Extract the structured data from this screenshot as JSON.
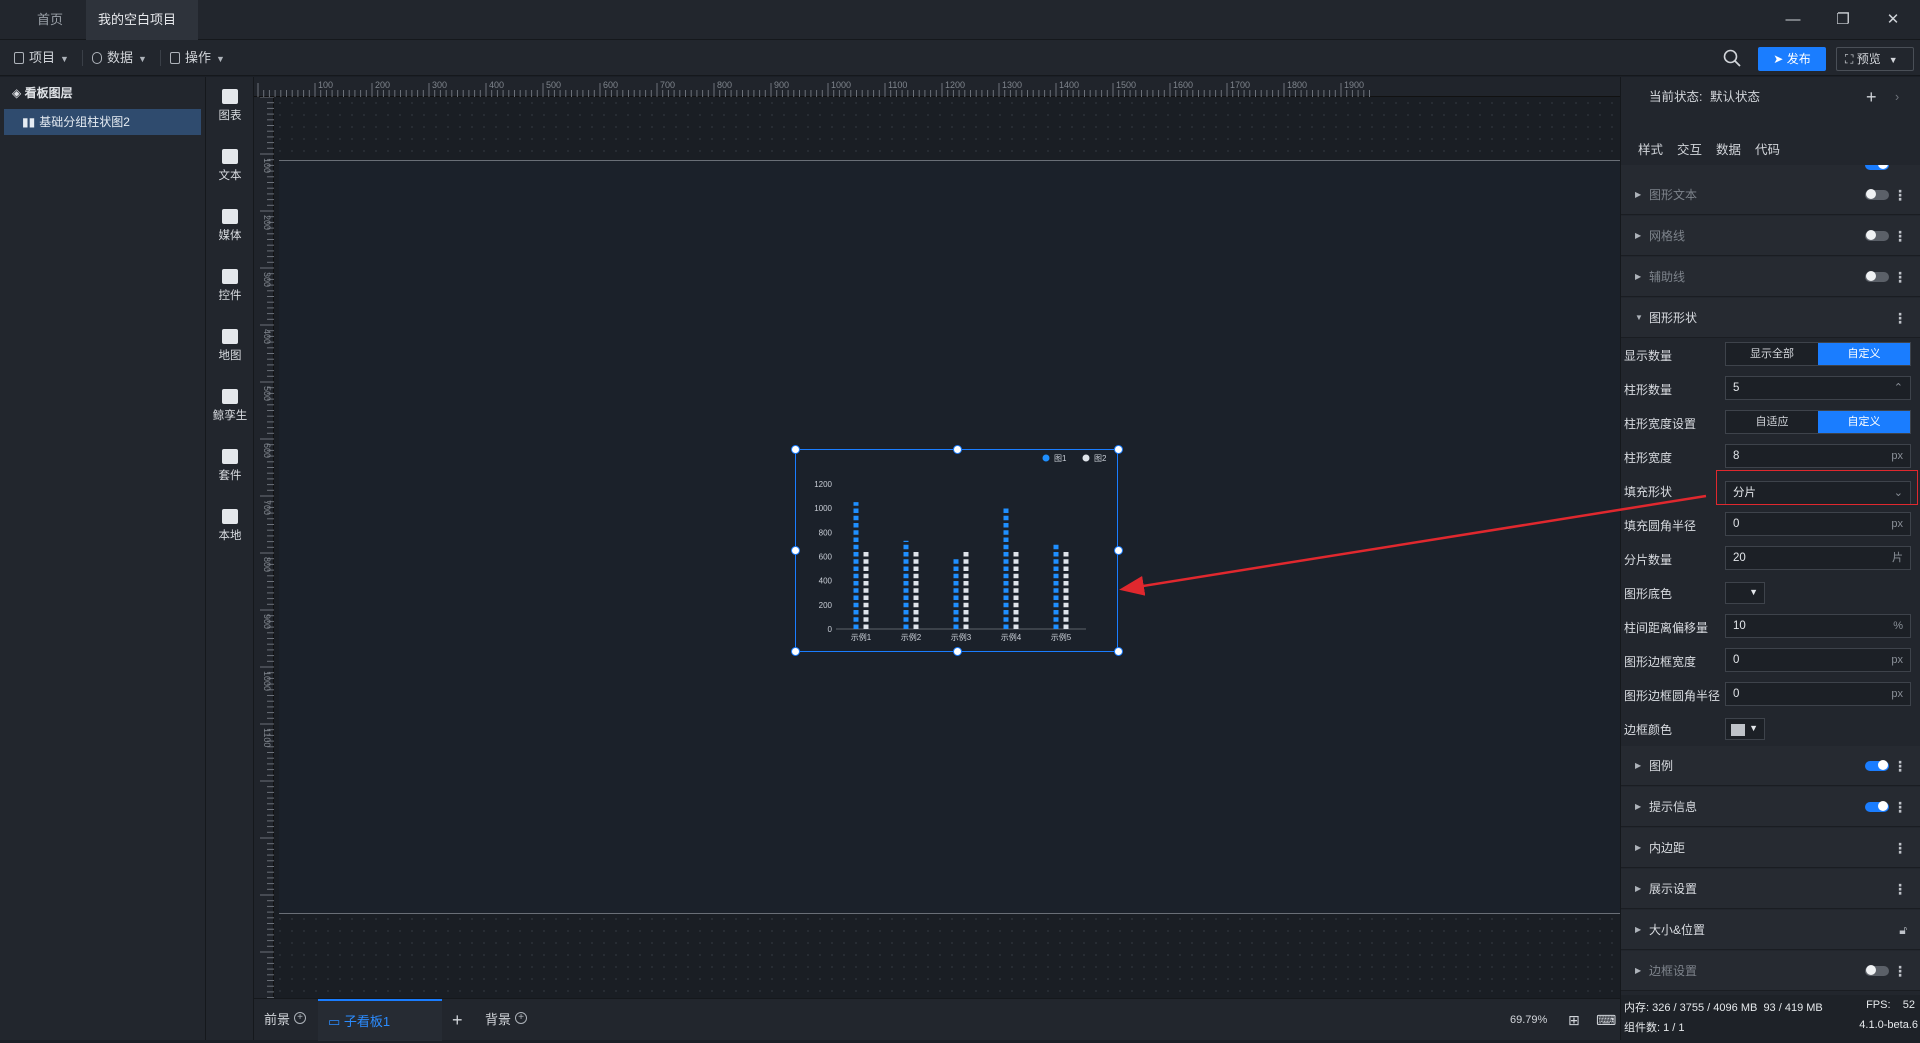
{
  "tabs": [
    {
      "label": "首页"
    },
    {
      "label": "我的空白项目"
    }
  ],
  "toolbar": {
    "project": "项目",
    "data": "数据",
    "ops": "操作",
    "publish": "发布",
    "preview": "预览"
  },
  "layers": {
    "title": "看板图层",
    "items": [
      {
        "label": "基础分组柱状图2"
      }
    ]
  },
  "components": [
    {
      "label": "图表"
    },
    {
      "label": "文本"
    },
    {
      "label": "媒体"
    },
    {
      "label": "控件"
    },
    {
      "label": "地图"
    },
    {
      "label": "鲸孪生"
    },
    {
      "label": "套件"
    },
    {
      "label": "本地"
    }
  ],
  "ruler": {
    "h": [
      "100",
      "200",
      "300",
      "400",
      "500",
      "600",
      "700",
      "800",
      "900",
      "1000",
      "1100",
      "1200",
      "1300",
      "1400",
      "1500",
      "1600",
      "1700",
      "1800",
      "1900"
    ],
    "v": [
      "100",
      "200",
      "300",
      "400",
      "500",
      "600",
      "700",
      "800",
      "900",
      "1000",
      "1100"
    ]
  },
  "chart_data": {
    "type": "bar",
    "categories": [
      "示例1",
      "示例2",
      "示例3",
      "示例4",
      "示例5"
    ],
    "series": [
      {
        "name": "图1",
        "values": [
          1050,
          730,
          590,
          1010,
          700
        ]
      },
      {
        "name": "图2",
        "values": [
          650,
          650,
          650,
          650,
          650
        ]
      }
    ],
    "yticks": [
      "0",
      "200",
      "400",
      "600",
      "800",
      "1000",
      "1200"
    ],
    "ylim": [
      0,
      1200
    ],
    "fill_shape": "分片",
    "segments": 20,
    "colors": [
      "#1f8fff",
      "#dfe4ea"
    ],
    "legend": "top-right"
  },
  "bottom": {
    "front": "前景",
    "board": "子看板1",
    "back": "背景",
    "zoom": "69.79%"
  },
  "props": {
    "state_label": "当前状态:",
    "state_value": "默认状态",
    "tabs": [
      "样式",
      "交互",
      "数据",
      "代码"
    ],
    "sections": {
      "text": "图形文本",
      "grid": "网格线",
      "aux": "辅助线",
      "shape": "图形形状",
      "legend": "图例",
      "tooltip": "提示信息",
      "padding": "内边距",
      "display": "展示设置",
      "size": "大小&位置",
      "border": "边框设置"
    },
    "fields": {
      "count_label": "显示数量",
      "count_all": "显示全部",
      "count_custom": "自定义",
      "bar_num_label": "柱形数量",
      "bar_num": "5",
      "width_set_label": "柱形宽度设置",
      "width_auto": "自适应",
      "width_custom": "自定义",
      "bar_width_label": "柱形宽度",
      "bar_width": "8",
      "px": "px",
      "fill_label": "填充形状",
      "fill_value": "分片",
      "radius_label": "填充圆角半径",
      "radius": "0",
      "seg_label": "分片数量",
      "seg": "20",
      "seg_unit": "片",
      "bg_label": "图形底色",
      "offset_label": "柱间距离偏移量",
      "offset": "10",
      "pct": "%",
      "bw_label": "图形边框宽度",
      "bw": "0",
      "br_label": "图形边框圆角半径",
      "br": "0",
      "bc_label": "边框颜色"
    },
    "status": {
      "mem_label": "内存:",
      "mem": "326 / 3755 / 4096 MB",
      "mem2": "93 / 419 MB",
      "fps_label": "FPS:",
      "fps": "52",
      "cmp_label": "组件数:",
      "cmp": "1 / 1",
      "version": "4.1.0-beta.6"
    }
  }
}
